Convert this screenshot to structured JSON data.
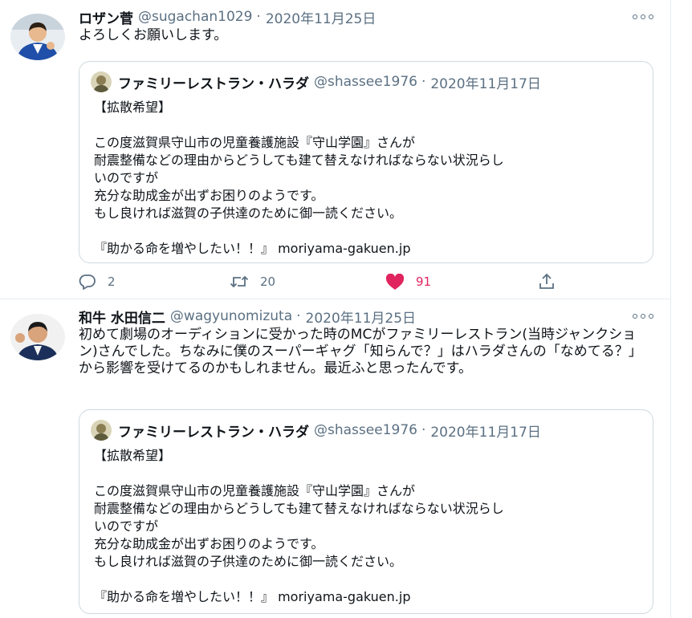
{
  "tweets": [
    {
      "name": "ロザン菅",
      "handle": "@sugachan1029",
      "dot": "·",
      "date": "2020年11月25日",
      "text": "よろしくお願いします。",
      "quote": {
        "name": "ファミリーレストラン・ハラダ",
        "handle": "@shassee1976",
        "dot": "·",
        "date": "2020年11月17日",
        "lines": [
          "【拡散希望】",
          "",
          "この度滋賀県守山市の児童養護施設『守山学園』さんが",
          "耐震整備などの理由からどうしても建て替えなければならない状況らし",
          "いのですが",
          "充分な助成金が出ずお困りのようです。",
          "もし良ければ滋賀の子供達のために御一読ください。",
          "",
          "『助かる命を増やしたい！！』 moriyama-gakuen.jp"
        ]
      },
      "actions": {
        "reply_count": "2",
        "retweet_count": "20",
        "like_count": "91"
      }
    },
    {
      "name": "和牛 水田信二",
      "handle": "@wagyunomizuta",
      "dot": "·",
      "date": "2020年11月25日",
      "text": "初めて劇場のオーディションに受かった時のMCがファミリーレストラン(当時ジャンクション)さんでした。ちなみに僕のスーパーギャグ「知らんで？」はハラダさんの「なめてる？」から影響を受けてるのかもしれません。最近ふと思ったんです。",
      "quote": {
        "name": "ファミリーレストラン・ハラダ",
        "handle": "@shassee1976",
        "dot": "·",
        "date": "2020年11月17日",
        "lines": [
          "【拡散希望】",
          "",
          "この度滋賀県守山市の児童養護施設『守山学園』さんが",
          "耐震整備などの理由からどうしても建て替えなければならない状況らし",
          "いのですが",
          "充分な助成金が出ずお困りのようです。",
          "もし良ければ滋賀の子供達のために御一読ください。",
          "",
          "『助かる命を増やしたい！！』 moriyama-gakuen.jp"
        ]
      }
    }
  ],
  "icons": {
    "reply": "reply-icon",
    "retweet": "retweet-icon",
    "like": "heart-icon",
    "share": "share-icon",
    "more": "more-icon"
  },
  "colors": {
    "secondary_text": "#5b7083",
    "like": "#e0245e",
    "border": "#cfd9de"
  }
}
